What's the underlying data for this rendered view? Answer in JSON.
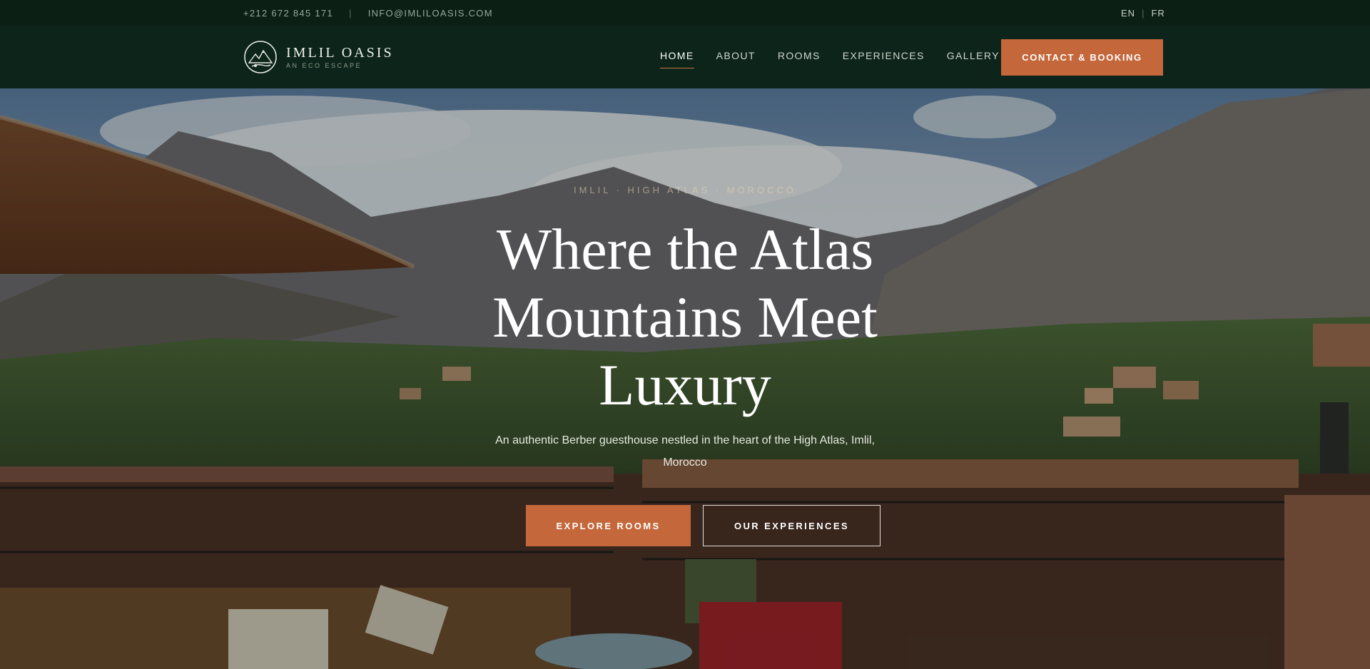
{
  "topbar": {
    "phone": "+212 672 845 171",
    "separator": "|",
    "email": "INFO@IMLILOASIS.COM",
    "languages": [
      "EN",
      "FR"
    ],
    "lang_divider": "|"
  },
  "header": {
    "logo_name": "IMLIL OASIS",
    "logo_tagline": "AN ECO ESCAPE",
    "nav": [
      {
        "label": "HOME",
        "active": true
      },
      {
        "label": "ABOUT",
        "active": false
      },
      {
        "label": "ROOMS",
        "active": false
      },
      {
        "label": "EXPERIENCES",
        "active": false
      },
      {
        "label": "GALLERY",
        "active": false
      }
    ],
    "cta_label": "CONTACT & BOOKING"
  },
  "hero": {
    "eyebrow": "IMLIL · HIGH ATLAS · MOROCCO",
    "headline_line1": "Where the Atlas",
    "headline_line2": "Mountains Meet",
    "headline_line3": "Luxury",
    "subtitle": "An authentic Berber guesthouse nestled in the heart of the High Atlas, Imlil, Morocco",
    "primary_button": "EXPLORE ROOMS",
    "secondary_button": "OUR EXPERIENCES"
  },
  "colors": {
    "header_bg": "#0c2419",
    "topbar_bg": "#0b1f15",
    "accent": "#c4673a",
    "text_light": "#ffffff"
  }
}
